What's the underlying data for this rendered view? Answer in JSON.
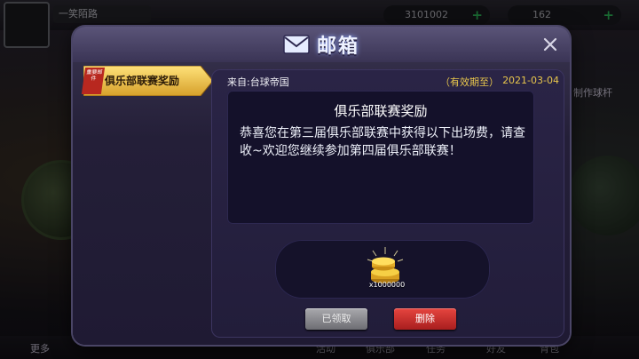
{
  "background": {
    "player_name": "一笑陌路",
    "coins": "3101002",
    "gems": "162",
    "craft_label": "制作球杆",
    "side_label_left": "更多",
    "bottom_nav": [
      "活动",
      "俱乐部",
      "任务",
      "好友",
      "背包"
    ]
  },
  "dialog": {
    "title": "邮箱",
    "close_icon": "close-icon",
    "mail_list": [
      {
        "badge": "重要邮件",
        "label": "俱乐部联赛奖励",
        "selected": true
      }
    ],
    "message": {
      "from": "来自:台球帝国",
      "expiry_label": "（有效期至）",
      "expiry_date": "2021-03-04",
      "title": "俱乐部联赛奖励",
      "body": "恭喜您在第三届俱乐部联赛中获得以下出场费，请查收~欢迎您继续参加第四届俱乐部联赛！",
      "reward": {
        "icon": "gold-coins-icon",
        "quantity": "x1000000"
      },
      "claimed_label": "已领取",
      "delete_label": "删除"
    }
  },
  "colors": {
    "accent_gold": "#e9c74c",
    "delete_red": "#d13a34",
    "claimed_gray": "#8c8c91",
    "panel_dark": "#14112a"
  }
}
